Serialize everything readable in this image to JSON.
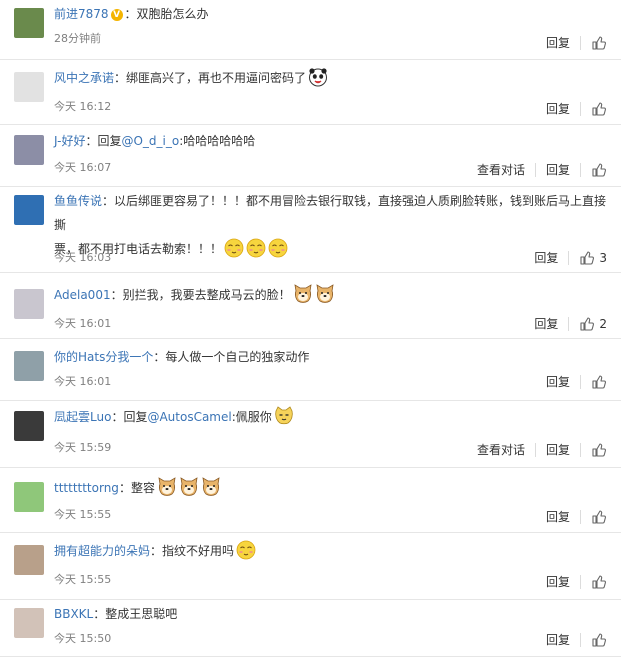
{
  "comments": [
    {
      "user": "前进7878",
      "prefix": "",
      "mention": "",
      "text": "：双胞胎怎么办",
      "time": "28分钟前",
      "talk": "",
      "reply": "回复",
      "likes": "",
      "verified": "V",
      "emoji": 0,
      "emoji_kind": "",
      "avatar": "#6a8a4c"
    },
    {
      "user": "风中之承诺",
      "prefix": "",
      "mention": "",
      "text": "：绑匪高兴了，再也不用逼问密码了",
      "time": "今天 16:12",
      "talk": "",
      "reply": "回复",
      "likes": "",
      "verified": "",
      "emoji": 1,
      "emoji_kind": "panda",
      "avatar": "#e2e2e2"
    },
    {
      "user": "J-好好",
      "prefix": "：回复",
      "mention": "@O_d_i_o",
      "text": ":哈哈哈哈哈哈",
      "time": "今天 16:07",
      "talk": "查看对话",
      "reply": "回复",
      "likes": "",
      "verified": "",
      "emoji": 0,
      "emoji_kind": "",
      "avatar": "#8c8ea6"
    },
    {
      "user": "鱼鱼传说",
      "prefix": "",
      "mention": "",
      "text": "：以后绑匪更容易了！！！都不用冒险去银行取钱，直接强迫人质刷脸转账，钱到账后马上直接撕",
      "text2": "票，都不用打电话去勒索！！！",
      "time": "今天 16:03",
      "talk": "",
      "reply": "回复",
      "likes": "3",
      "verified": "",
      "emoji": 3,
      "emoji_kind": "face",
      "avatar": "#2f6fb3"
    },
    {
      "user": "Adela001",
      "prefix": "",
      "mention": "",
      "text": "：别拦我，我要去整成马云的脸！",
      "time": "今天 16:01",
      "talk": "",
      "reply": "回复",
      "likes": "2",
      "verified": "",
      "emoji": 2,
      "emoji_kind": "doge",
      "avatar": "#c9c6cf"
    },
    {
      "user": "你的Hats分我一个",
      "prefix": "",
      "mention": "",
      "text": "：每人做一个自己的独家动作",
      "time": "今天 16:01",
      "talk": "",
      "reply": "回复",
      "likes": "",
      "verified": "",
      "emoji": 0,
      "emoji_kind": "",
      "avatar": "#8fa0a8"
    },
    {
      "user": "凨起雲Luo",
      "prefix": "：回复",
      "mention": "@AutosCamel",
      "text": ":佩服你",
      "time": "今天 15:59",
      "talk": "查看对话",
      "reply": "回复",
      "likes": "",
      "verified": "",
      "emoji": 1,
      "emoji_kind": "cat",
      "avatar": "#3a3a3a"
    },
    {
      "user": "ttttttttorng",
      "prefix": "",
      "mention": "",
      "text": "：整容",
      "time": "今天 15:55",
      "talk": "",
      "reply": "回复",
      "likes": "",
      "verified": "",
      "emoji": 3,
      "emoji_kind": "doge",
      "avatar": "#8fc77a"
    },
    {
      "user": "拥有超能力的朵妈",
      "prefix": "",
      "mention": "",
      "text": "：指纹不好用吗",
      "time": "今天 15:55",
      "talk": "",
      "reply": "回复",
      "likes": "",
      "verified": "",
      "emoji": 1,
      "emoji_kind": "face",
      "avatar": "#b8a08a"
    },
    {
      "user": "BBXKL",
      "prefix": "",
      "mention": "",
      "text": "：整成王思聪吧",
      "time": "今天 15:50",
      "talk": "",
      "reply": "回复",
      "likes": "",
      "verified": "",
      "emoji": 0,
      "emoji_kind": "",
      "avatar": "#d2c2b8"
    }
  ]
}
